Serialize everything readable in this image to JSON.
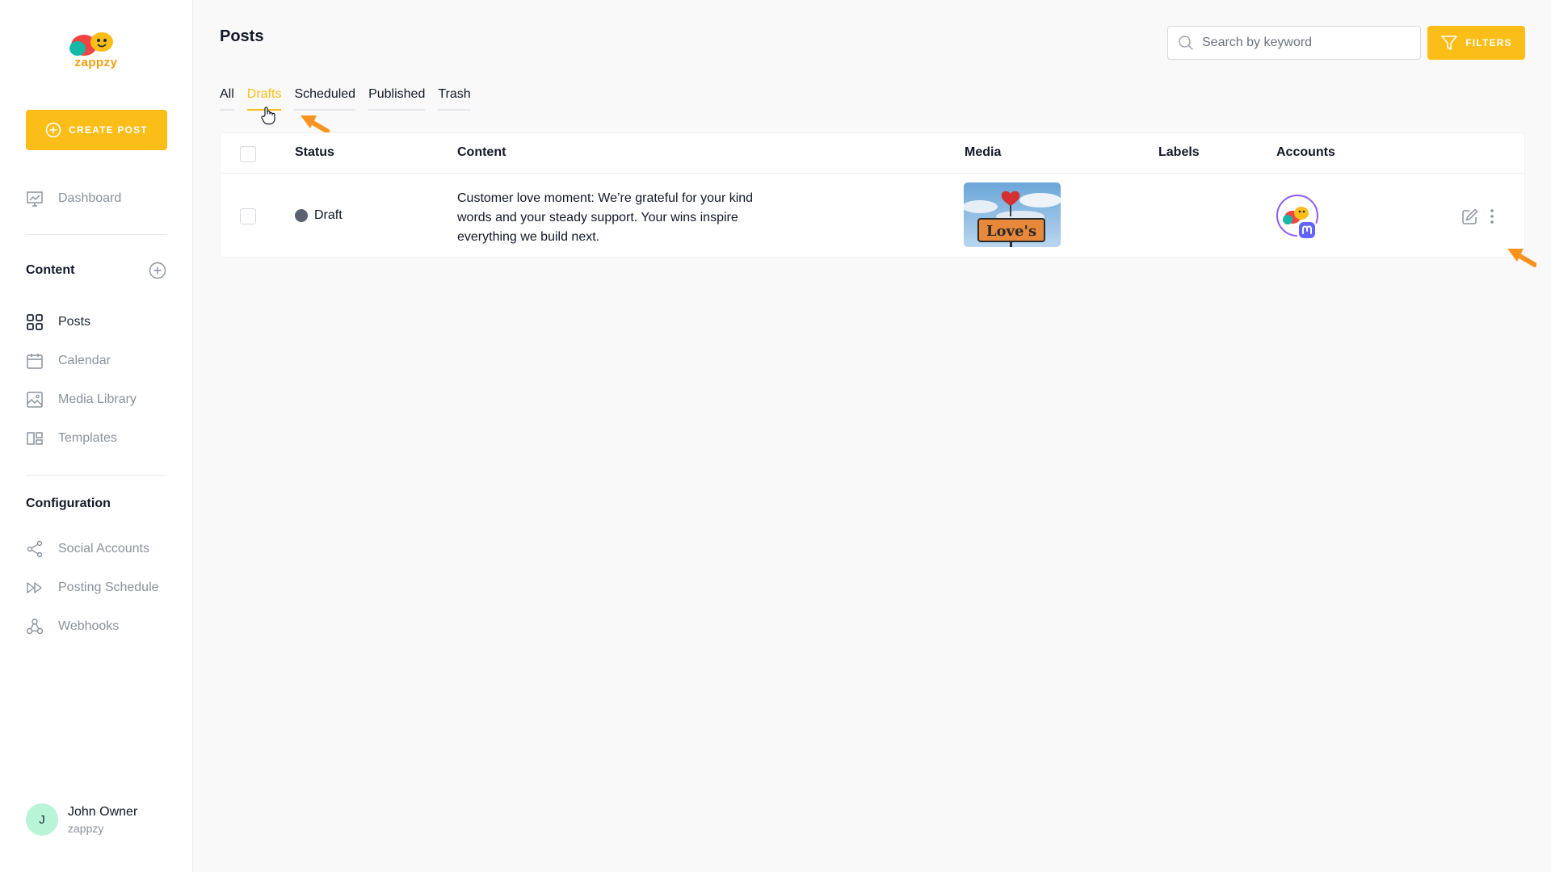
{
  "brand": {
    "name": "zappzy",
    "accent": "#fbbd17"
  },
  "sidebar": {
    "create_button": "CREATE POST",
    "dashboard": {
      "label": "Dashboard",
      "icon": "chart-icon"
    },
    "content_title": "Content",
    "content_items": [
      {
        "label": "Posts",
        "icon": "grid-icon",
        "active": true
      },
      {
        "label": "Calendar",
        "icon": "calendar-icon"
      },
      {
        "label": "Media Library",
        "icon": "image-icon"
      },
      {
        "label": "Templates",
        "icon": "templates-icon"
      }
    ],
    "config_title": "Configuration",
    "config_items": [
      {
        "label": "Social Accounts",
        "icon": "share-icon"
      },
      {
        "label": "Posting Schedule",
        "icon": "schedule-icon"
      },
      {
        "label": "Webhooks",
        "icon": "webhook-icon"
      }
    ],
    "user": {
      "initial": "J",
      "name": "John Owner",
      "org": "zappzy"
    }
  },
  "main": {
    "title": "Posts",
    "search": {
      "placeholder": "Search by keyword",
      "value": ""
    },
    "filters_label": "FILTERS",
    "tabs": [
      {
        "label": "All"
      },
      {
        "label": "Drafts",
        "active": true
      },
      {
        "label": "Scheduled"
      },
      {
        "label": "Published"
      },
      {
        "label": "Trash"
      }
    ],
    "table": {
      "headers": {
        "status": "Status",
        "content": "Content",
        "media": "Media",
        "labels": "Labels",
        "accounts": "Accounts"
      },
      "rows": [
        {
          "status": "Draft",
          "status_color": "#5b6171",
          "content": "Customer love moment: We’re grateful for your kind words and your steady support. Your wins inspire everything we build next.",
          "media_sign_text": "Love's",
          "labels": "",
          "account_network": "mastodon-icon"
        }
      ]
    }
  }
}
